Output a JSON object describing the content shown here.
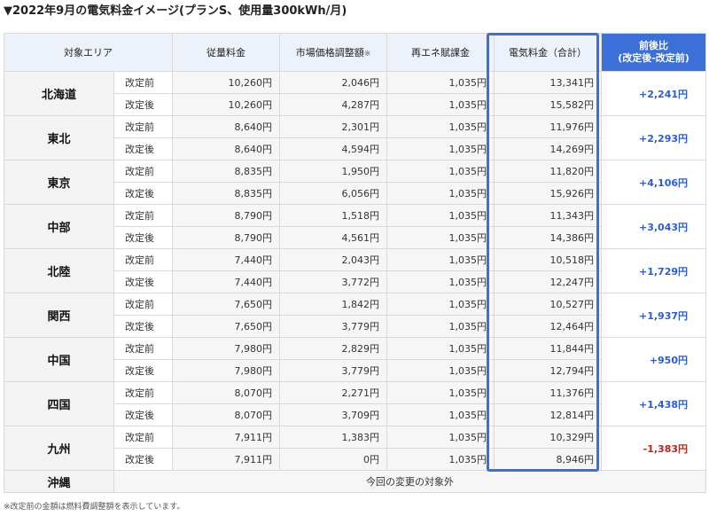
{
  "title": "▼2022年9月の電気料金イメージ(プランS、使用量300kWh/月)",
  "headers": {
    "area": "対象エリア",
    "usage": "従量料金",
    "market": "市場価格調整額",
    "market_note": "※",
    "renew": "再エネ賦課金",
    "total": "電気料金（合計）",
    "diff_line1": "前後比",
    "diff_line2": "(改定後-改定前)"
  },
  "labels": {
    "before": "改定前",
    "after": "改定後"
  },
  "areas": [
    {
      "name": "北海道",
      "before": {
        "usage": "10,260円",
        "market": "2,046円",
        "renew": "1,035円",
        "total": "13,341円"
      },
      "after": {
        "usage": "10,260円",
        "market": "4,287円",
        "renew": "1,035円",
        "total": "15,582円"
      },
      "diff": "+2,241円",
      "negative": false
    },
    {
      "name": "東北",
      "before": {
        "usage": "8,640円",
        "market": "2,301円",
        "renew": "1,035円",
        "total": "11,976円"
      },
      "after": {
        "usage": "8,640円",
        "market": "4,594円",
        "renew": "1,035円",
        "total": "14,269円"
      },
      "diff": "+2,293円",
      "negative": false
    },
    {
      "name": "東京",
      "before": {
        "usage": "8,835円",
        "market": "1,950円",
        "renew": "1,035円",
        "total": "11,820円"
      },
      "after": {
        "usage": "8,835円",
        "market": "6,056円",
        "renew": "1,035円",
        "total": "15,926円"
      },
      "diff": "+4,106円",
      "negative": false
    },
    {
      "name": "中部",
      "before": {
        "usage": "8,790円",
        "market": "1,518円",
        "renew": "1,035円",
        "total": "11,343円"
      },
      "after": {
        "usage": "8,790円",
        "market": "4,561円",
        "renew": "1,035円",
        "total": "14,386円"
      },
      "diff": "+3,043円",
      "negative": false
    },
    {
      "name": "北陸",
      "before": {
        "usage": "7,440円",
        "market": "2,043円",
        "renew": "1,035円",
        "total": "10,518円"
      },
      "after": {
        "usage": "7,440円",
        "market": "3,772円",
        "renew": "1,035円",
        "total": "12,247円"
      },
      "diff": "+1,729円",
      "negative": false
    },
    {
      "name": "関西",
      "before": {
        "usage": "7,650円",
        "market": "1,842円",
        "renew": "1,035円",
        "total": "10,527円"
      },
      "after": {
        "usage": "7,650円",
        "market": "3,779円",
        "renew": "1,035円",
        "total": "12,464円"
      },
      "diff": "+1,937円",
      "negative": false
    },
    {
      "name": "中国",
      "before": {
        "usage": "7,980円",
        "market": "2,829円",
        "renew": "1,035円",
        "total": "11,844円"
      },
      "after": {
        "usage": "7,980円",
        "market": "3,779円",
        "renew": "1,035円",
        "total": "12,794円"
      },
      "diff": "+950円",
      "negative": false
    },
    {
      "name": "四国",
      "before": {
        "usage": "8,070円",
        "market": "2,271円",
        "renew": "1,035円",
        "total": "11,376円"
      },
      "after": {
        "usage": "8,070円",
        "market": "3,709円",
        "renew": "1,035円",
        "total": "12,814円"
      },
      "diff": "+1,438円",
      "negative": false
    },
    {
      "name": "九州",
      "before": {
        "usage": "7,911円",
        "market": "1,383円",
        "renew": "1,035円",
        "total": "10,329円"
      },
      "after": {
        "usage": "7,911円",
        "market": "0円",
        "renew": "1,035円",
        "total": "8,946円"
      },
      "diff": "-1,383円",
      "negative": true
    }
  ],
  "okinawa": {
    "name": "沖縄",
    "note": "今回の変更の対象外"
  },
  "footnote": "※改定前の金額は燃料費調整額を表示しています。",
  "colors": {
    "accent": "#3c6fd8",
    "positive": "#2a5bd7",
    "negative": "#b3261e"
  }
}
